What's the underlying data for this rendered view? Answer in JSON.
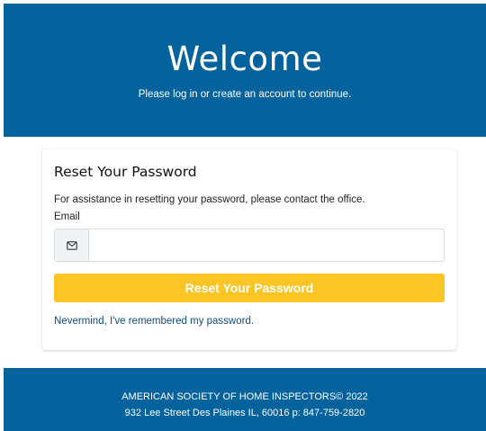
{
  "hero": {
    "title": "Welcome",
    "subtitle": "Please log in or create an account to continue."
  },
  "card": {
    "title": "Reset Your Password",
    "assistance_text": "For assistance in resetting your password, please contact the office.",
    "email_label": "Email",
    "email_value": "",
    "email_placeholder": "",
    "email_icon": "envelope-icon",
    "submit_label": "Reset Your Password",
    "nevermind_link": "Nevermind, I've remembered my password."
  },
  "footer": {
    "line1": "AMERICAN SOCIETY OF HOME INSPECTORS© 2022",
    "line2": "932 Lee Street Des Plaines IL, 60016 p: 847-759-2820"
  },
  "colors": {
    "brand_blue": "#04629d",
    "button_yellow": "#fcc526",
    "link_blue": "#0f4c81"
  }
}
